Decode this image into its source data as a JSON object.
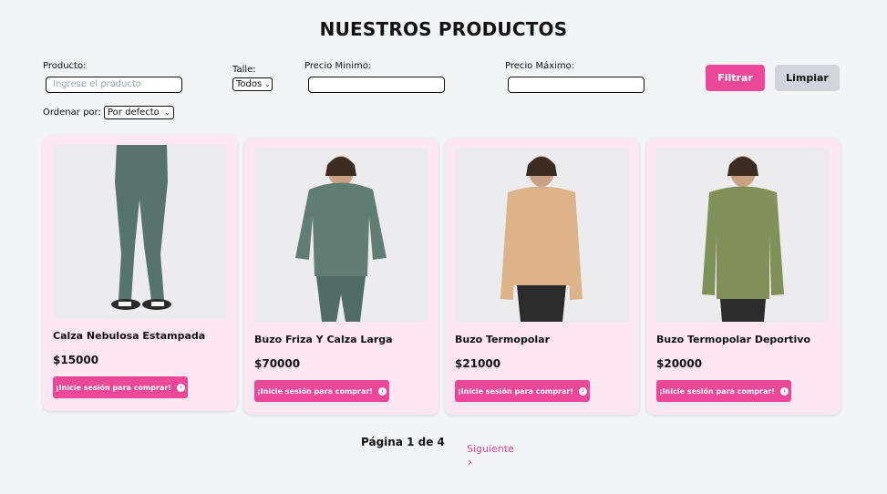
{
  "page": {
    "title": "NUESTROS PRODUCTOS"
  },
  "filters": {
    "product_label": "Producto:",
    "product_placeholder": "Ingrese el producto",
    "size_label": "Talle:",
    "size_value": "Todos",
    "min_price_label": "Precio Minimo:",
    "max_price_label": "Precio Máximo:",
    "filter_button": "Filtrar",
    "clear_button": "Limpiar",
    "sort_label": "Ordenar por:",
    "sort_value": "Por defecto"
  },
  "products": [
    {
      "name": "Calza Nebulosa Estampada",
      "price": "$15000",
      "buy_label": "¡Inicie sesión para comprar!",
      "garment": "leggings",
      "color": "#4f6d65"
    },
    {
      "name": "Buzo Friza Y Calza Larga",
      "price": "$70000",
      "buy_label": "¡Inicie sesión para comprar!",
      "garment": "hoodie",
      "color": "#5f7d72"
    },
    {
      "name": "Buzo Termopolar",
      "price": "$21000",
      "buy_label": "¡Inicie sesión para comprar!",
      "garment": "pullover",
      "color": "#ddb38a"
    },
    {
      "name": "Buzo Termopolar Deportivo",
      "price": "$20000",
      "buy_label": "¡Inicie sesión para comprar!",
      "garment": "pullover",
      "color": "#7f9158"
    }
  ],
  "pagination": {
    "info": "Página 1 de 4",
    "next_label": "Siguiente"
  },
  "colors": {
    "accent": "#ec4899",
    "card_bg": "#fce7f3",
    "page_bg": "#f3f4f6"
  }
}
